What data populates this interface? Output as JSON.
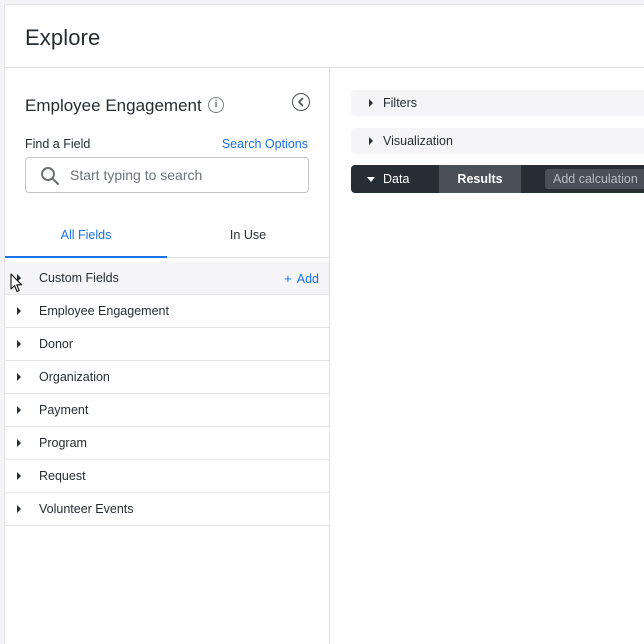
{
  "header": {
    "title": "Explore"
  },
  "sidebar": {
    "title": "Employee Engagement",
    "find_label": "Find a Field",
    "search_options_label": "Search Options",
    "search_placeholder": "Start typing to search",
    "tabs": [
      {
        "label": "All Fields",
        "active": true
      },
      {
        "label": "In Use",
        "active": false
      }
    ],
    "fields": [
      {
        "label": "Custom Fields",
        "action": "Add"
      },
      {
        "label": "Employee Engagement"
      },
      {
        "label": "Donor"
      },
      {
        "label": "Organization"
      },
      {
        "label": "Payment"
      },
      {
        "label": "Program"
      },
      {
        "label": "Request"
      },
      {
        "label": "Volunteer Events"
      }
    ]
  },
  "main": {
    "filters_label": "Filters",
    "visualization_label": "Visualization",
    "data_label": "Data",
    "results_label": "Results",
    "add_calculation_label": "Add calculation"
  },
  "colors": {
    "accent": "#1a73e8",
    "data_bar": "#262d33",
    "panel_bg": "#f5f5f7"
  },
  "icons": {
    "info": "info-icon",
    "collapse": "chevron-left-circle-icon",
    "search": "search-icon",
    "expand": "caret-right-icon",
    "cursor": "mouse-pointer-icon"
  }
}
